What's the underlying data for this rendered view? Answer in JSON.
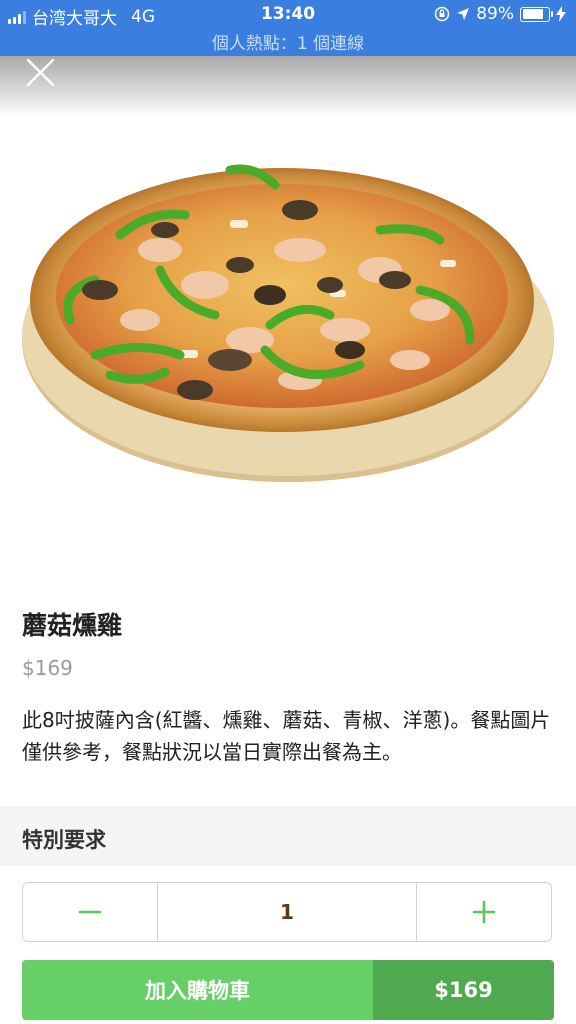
{
  "status_bar": {
    "carrier": "台湾大哥大",
    "network": "4G",
    "time": "13:40",
    "battery": "89%",
    "battery_level": 0.89,
    "hotspot_text": "個人熱點：1 個連線"
  },
  "product": {
    "name": "蘑菇燻雞",
    "price": "$169",
    "description": "此8吋披薩內含(紅醬、燻雞、蘑菇、青椒、洋蔥)。餐點圖片僅供參考，餐點狀況以當日實際出餐為主。"
  },
  "special_request": {
    "label": "特別要求"
  },
  "quantity": {
    "value": "1",
    "minus_icon": "minus-icon",
    "plus_icon": "plus-icon"
  },
  "cart": {
    "label": "加入購物車",
    "price": "$169"
  },
  "colors": {
    "status_bar": "#3a7fe0",
    "accent_green": "#66cf66",
    "accent_green_dark": "#4faa4f"
  }
}
